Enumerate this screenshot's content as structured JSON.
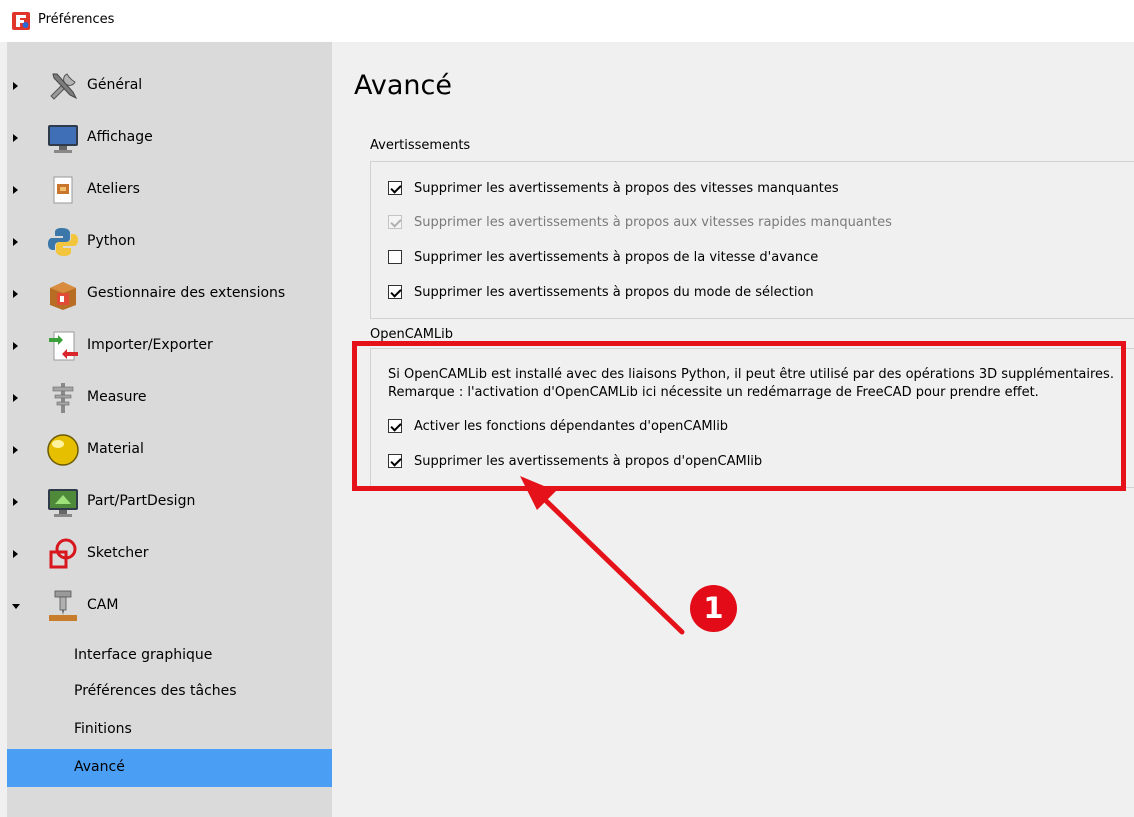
{
  "window": {
    "title": "Préférences",
    "icon": "freecad-icon"
  },
  "sidebar": {
    "items": [
      {
        "label": "Général",
        "icon": "tools-icon",
        "expanded": false
      },
      {
        "label": "Affichage",
        "icon": "monitor-icon",
        "expanded": false
      },
      {
        "label": "Ateliers",
        "icon": "workbench-icon",
        "expanded": false
      },
      {
        "label": "Python",
        "icon": "python-icon",
        "expanded": false
      },
      {
        "label": "Gestionnaire des extensions",
        "icon": "addon-manager-icon",
        "expanded": false
      },
      {
        "label": "Importer/Exporter",
        "icon": "import-export-icon",
        "expanded": false
      },
      {
        "label": "Measure",
        "icon": "measure-icon",
        "expanded": false
      },
      {
        "label": "Material",
        "icon": "material-sphere-icon",
        "expanded": false
      },
      {
        "label": "Part/PartDesign",
        "icon": "part-design-icon",
        "expanded": false
      },
      {
        "label": "Sketcher",
        "icon": "sketcher-icon",
        "expanded": false
      },
      {
        "label": "CAM",
        "icon": "cam-icon",
        "expanded": true
      }
    ],
    "cam_subitems": [
      {
        "label": "Interface graphique",
        "selected": false
      },
      {
        "label": "Préférences des tâches",
        "selected": false
      },
      {
        "label": "Finitions",
        "selected": false
      },
      {
        "label": "Avancé",
        "selected": true
      }
    ],
    "selection_color": "#4a9ff5"
  },
  "main": {
    "title": "Avancé",
    "warnings_group": {
      "title": "Avertissements",
      "checkboxes": [
        {
          "label": "Supprimer les avertissements à propos des vitesses manquantes",
          "checked": true,
          "enabled": true
        },
        {
          "label": "Supprimer les avertissements à propos aux vitesses rapides manquantes",
          "checked": true,
          "enabled": false
        },
        {
          "label": "Supprimer les avertissements à propos de la vitesse d'avance",
          "checked": false,
          "enabled": true
        },
        {
          "label": "Supprimer les avertissements à propos du mode de sélection",
          "checked": true,
          "enabled": true
        }
      ]
    },
    "opencamlib_group": {
      "title": "OpenCAMLib",
      "info_line1": "Si OpenCAMLib est installé avec des liaisons Python, il peut être utilisé par des opérations 3D supplémentaires.",
      "info_line2": "Remarque : l'activation d'OpenCAMLib ici nécessite un redémarrage de FreeCAD pour prendre effet.",
      "checkboxes": [
        {
          "label": "Activer les fonctions dépendantes d'openCAMlib",
          "checked": true,
          "enabled": true
        },
        {
          "label": "Supprimer les avertissements à propos d'openCAMlib",
          "checked": true,
          "enabled": true
        }
      ]
    }
  },
  "annotation": {
    "badge": "1",
    "color": "#e5121a"
  }
}
